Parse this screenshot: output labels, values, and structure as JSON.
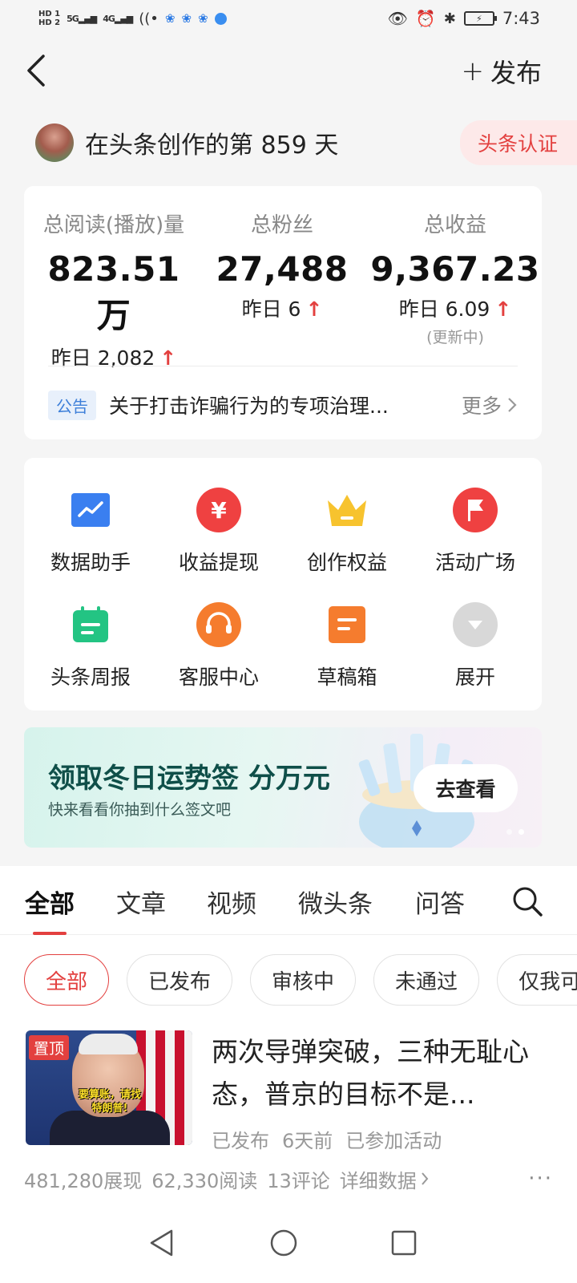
{
  "status_bar": {
    "hd1": "HD 1",
    "hd2": "HD 2",
    "sig1": "5G",
    "sig2": "4G",
    "time": "7:43"
  },
  "header": {
    "publish_label": "发布"
  },
  "creator": {
    "prefix": "在头条创作的第",
    "days": "859",
    "suffix": "天",
    "verify_label": "头条认证"
  },
  "stats": [
    {
      "label": "总阅读(播放)量",
      "value": "823.51万",
      "delta": "昨日 2,082",
      "sub": ""
    },
    {
      "label": "总粉丝",
      "value": "27,488",
      "delta": "昨日 6",
      "sub": ""
    },
    {
      "label": "总收益",
      "value": "9,367.23",
      "delta": "昨日 6.09",
      "sub": "(更新中)"
    }
  ],
  "notice": {
    "tag": "公告",
    "text": "关于打击诈骗行为的专项治理...",
    "more": "更多"
  },
  "tools": [
    {
      "label": "数据助手",
      "icon": "chart-icon",
      "color": "#3a7ff0"
    },
    {
      "label": "收益提现",
      "icon": "yuan-icon",
      "color": "#ef4141"
    },
    {
      "label": "创作权益",
      "icon": "crown-icon",
      "color": "#f7c32e"
    },
    {
      "label": "活动广场",
      "icon": "flag-icon",
      "color": "#ef4141"
    },
    {
      "label": "头条周报",
      "icon": "calendar-icon",
      "color": "#23c483"
    },
    {
      "label": "客服中心",
      "icon": "headset-icon",
      "color": "#f57c2e"
    },
    {
      "label": "草稿箱",
      "icon": "draft-icon",
      "color": "#f57c2e"
    },
    {
      "label": "展开",
      "icon": "chevron-down-icon",
      "color": "#d8d8d8"
    }
  ],
  "banner": {
    "title": "领取冬日运势签 分万元",
    "subtitle": "快来看看你抽到什么签文吧",
    "button": "去查看"
  },
  "tabs": [
    "全部",
    "文章",
    "视频",
    "微头条",
    "问答"
  ],
  "filters": [
    "全部",
    "已发布",
    "审核中",
    "未通过",
    "仅我可见"
  ],
  "article": {
    "pin_tag": "置顶",
    "thumb_caption": "要算账，请找特朗普!",
    "title": "两次导弹突破，三种无耻心态，普京的目标不是...",
    "status": "已发布",
    "time": "6天前",
    "activity": "已参加活动",
    "impressions": "481,280展现",
    "reads": "62,330阅读",
    "comments": "13评论",
    "detail_link": "详细数据",
    "more": "···"
  },
  "colors": {
    "accent": "#e3403f",
    "notice_blue": "#3d7fd9",
    "banner_text": "#0f4f49"
  }
}
